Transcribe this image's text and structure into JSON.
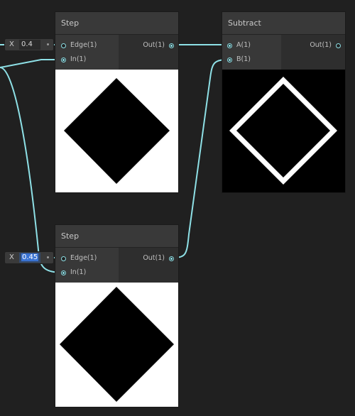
{
  "nodes": {
    "step_top": {
      "title": "Step",
      "inputs": [
        {
          "label": "Edge(1)"
        },
        {
          "label": "In(1)"
        }
      ],
      "output": {
        "label": "Out(1)"
      },
      "preview": "white-background-black-diamond"
    },
    "subtract": {
      "title": "Subtract",
      "inputs": [
        {
          "label": "A(1)"
        },
        {
          "label": "B(1)"
        }
      ],
      "output": {
        "label": "Out(1)"
      },
      "preview": "black-background-white-diamond-outline"
    },
    "step_bottom": {
      "title": "Step",
      "inputs": [
        {
          "label": "Edge(1)"
        },
        {
          "label": "In(1)"
        }
      ],
      "output": {
        "label": "Out(1)"
      },
      "preview": "white-background-black-diamond"
    }
  },
  "fields": {
    "edge_top": {
      "axis": "X",
      "value": "0.4"
    },
    "edge_bottom": {
      "axis": "X",
      "value": "0.45",
      "selected": true
    }
  },
  "colors": {
    "wire": "#8ee0e6",
    "canvas": "#202020",
    "node_header": "#393939",
    "node_body": "#2b2b2b"
  }
}
